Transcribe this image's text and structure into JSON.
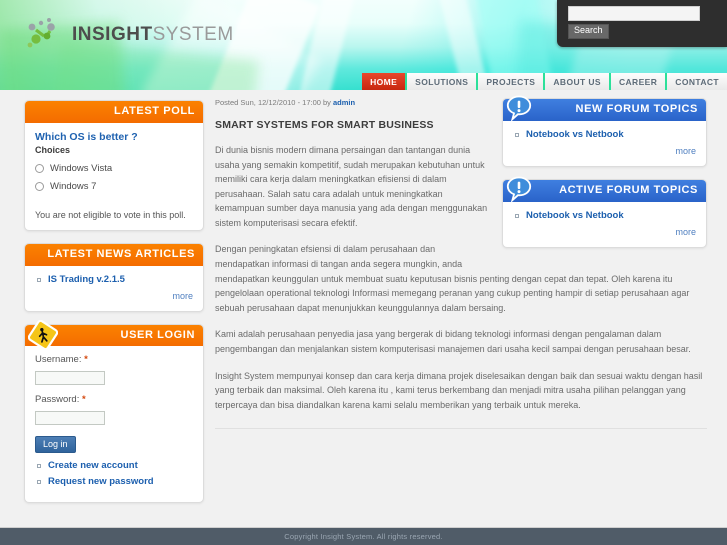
{
  "header": {
    "logo": {
      "part1": "INSIGHT",
      "part2": "SYSTEM",
      "icon": "molecule-logo-icon"
    },
    "search": {
      "value": "",
      "placeholder": "",
      "button_label": "Search"
    },
    "nav": [
      {
        "label": "HOME",
        "active": true
      },
      {
        "label": "SOLUTIONS",
        "active": false
      },
      {
        "label": "PROJECTS",
        "active": false
      },
      {
        "label": "ABOUT US",
        "active": false
      },
      {
        "label": "CAREER",
        "active": false
      },
      {
        "label": "CONTACT",
        "active": false
      }
    ]
  },
  "sidebar": {
    "poll": {
      "title": "LATEST POLL",
      "question": "Which OS is better ?",
      "choices_label": "Choices",
      "options": [
        {
          "label": "Windows Vista",
          "selected": false
        },
        {
          "label": "Windows 7",
          "selected": false
        }
      ],
      "note": "You are not eligible to vote in this poll."
    },
    "news": {
      "title": "LATEST NEWS ARTICLES",
      "items": [
        {
          "label": "IS Trading v.2.1.5"
        }
      ],
      "more_label": "more"
    },
    "login": {
      "title": "USER LOGIN",
      "icon": "pedestrian-crossing-sign-icon",
      "username_label": "Username:",
      "username_value": "",
      "password_label": "Password:",
      "password_value": "",
      "required_mark": "*",
      "submit_label": "Log in",
      "links": [
        {
          "label": "Create new account"
        },
        {
          "label": "Request new password"
        }
      ]
    }
  },
  "main": {
    "posted_prefix": "Posted Sun, 12/12/2010 - 17:00 by",
    "posted_author": "admin",
    "article_title": "SMART SYSTEMS FOR SMART BUSINESS",
    "paragraphs": [
      "Di dunia bisnis modern dimana persaingan dan tantangan dunia usaha yang semakin kompetitif, sudah merupakan kebutuhan untuk memiliki cara kerja dalam meningkatkan efisiensi di dalam perusahaan. Salah satu cara adalah untuk meningkatkan kemampuan sumber daya manusia yang ada dengan menggunakan sistem komputerisasi secara efektif.",
      "Dengan peningkatan efsiensi di dalam perusahaan dan mendapatkan informasi di tangan anda segera mungkin, anda mendapatkan keunggulan untuk membuat suatu keputusan bisnis penting dengan cepat dan tepat. Oleh karena itu pengelolaan operational teknologi Informasi memegang peranan yang cukup penting hampir di setiap perusahaan agar sebuah perusahaan dapat menunjukkan keunggulannya dalam bersaing.",
      "Kami adalah perusahaan penyedia jasa yang bergerak di bidang teknologi informasi dengan pengalaman dalam pengembangan dan menjalankan sistem komputerisasi manajemen dari usaha kecil sampai dengan perusahaan besar.",
      "Insight System mempunyai konsep dan cara kerja dimana projek diselesaikan dengan baik dan sesuai waktu dengan hasil yang terbaik dan maksimal. Oleh karena itu , kami terus berkembang dan menjadi mitra usaha pilihan pelanggan yang terpercaya dan bisa diandalkan karena kami selalu memberikan yang terbaik untuk mereka."
    ]
  },
  "rail": {
    "new_forum": {
      "title": "NEW FORUM TOPICS",
      "icon": "speech-bubble-exclamation-icon",
      "items": [
        {
          "label": "Notebook vs Netbook"
        }
      ],
      "more_label": "more"
    },
    "active_forum": {
      "title": "ACTIVE FORUM TOPICS",
      "icon": "speech-bubble-exclamation-icon",
      "items": [
        {
          "label": "Notebook vs Netbook"
        }
      ],
      "more_label": "more"
    }
  },
  "footer": {
    "text": "Copyright Insight System. All rights reserved."
  },
  "colors": {
    "orange": "#f87200",
    "blue": "#2f6bd4",
    "red": "#d8301a",
    "green_separator": "#2ce09a",
    "link_blue": "#1c5fae",
    "footer_bg": "#505c68"
  }
}
